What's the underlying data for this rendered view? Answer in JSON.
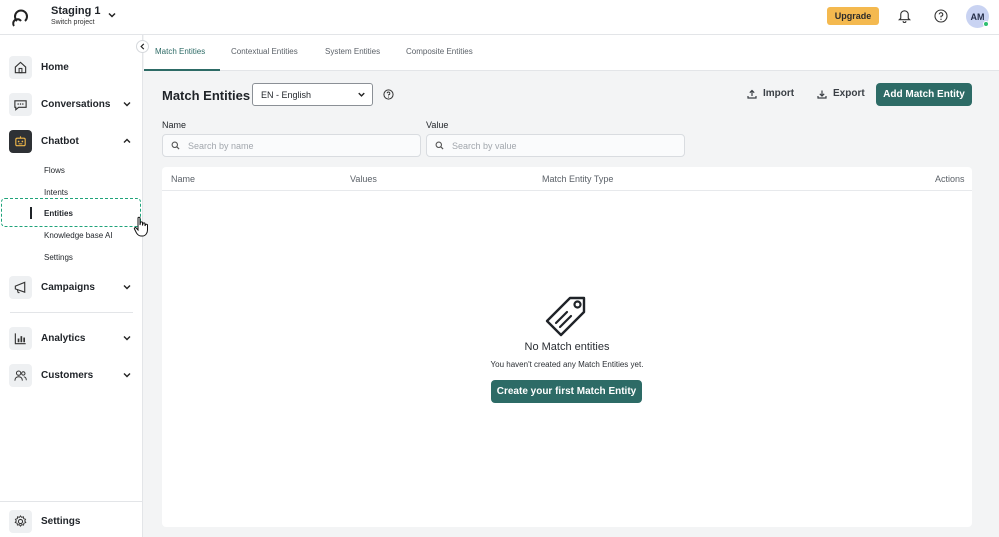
{
  "header": {
    "project_name": "Staging 1",
    "project_sub": "Switch project",
    "upgrade_label": "Upgrade",
    "avatar_initials": "AM"
  },
  "sidebar": {
    "items": [
      {
        "label": "Home",
        "icon": "home-icon"
      },
      {
        "label": "Conversations",
        "icon": "chat-bubble-icon"
      },
      {
        "label": "Chatbot",
        "icon": "robot-icon"
      },
      {
        "label": "Campaigns",
        "icon": "megaphone-icon"
      },
      {
        "label": "Analytics",
        "icon": "bar-chart-icon"
      },
      {
        "label": "Customers",
        "icon": "users-icon"
      }
    ],
    "chatbot_sub": [
      "Flows",
      "Intents",
      "Entities",
      "Knowledge base AI",
      "Settings"
    ],
    "active_sub": "Entities",
    "bottom_label": "Settings"
  },
  "tabs": [
    "Match Entities",
    "Contextual Entities",
    "System Entities",
    "Composite Entities"
  ],
  "main": {
    "title": "Match Entities",
    "language": "EN - English",
    "import_label": "Import",
    "export_label": "Export",
    "add_label": "Add Match Entity",
    "filters": {
      "name_label": "Name",
      "name_placeholder": "Search by name",
      "value_label": "Value",
      "value_placeholder": "Search by value"
    },
    "columns": [
      "Name",
      "Values",
      "Match Entity Type",
      "Actions"
    ],
    "empty": {
      "title": "No Match entities",
      "subtitle": "You haven't created any Match Entities yet.",
      "cta": "Create your first Match Entity"
    }
  },
  "colors": {
    "accent": "#2d6b66",
    "upgrade": "#f4b94f",
    "selection": "#1fa37a"
  }
}
